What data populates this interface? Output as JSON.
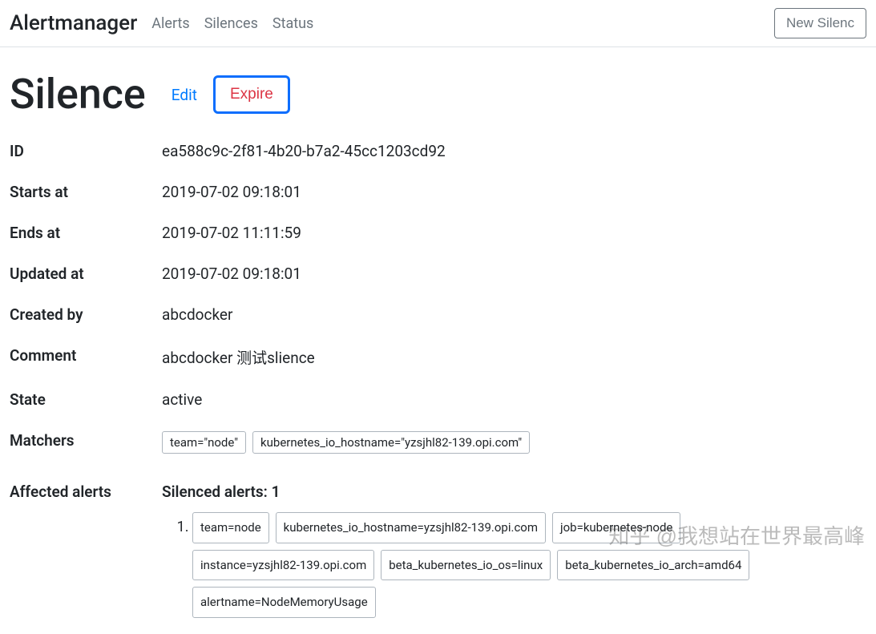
{
  "navbar": {
    "brand": "Alertmanager",
    "links": {
      "alerts": "Alerts",
      "silences": "Silences",
      "status": "Status"
    },
    "new_silence": "New Silenc"
  },
  "page": {
    "title": "Silence",
    "edit": "Edit",
    "expire": "Expire"
  },
  "labels": {
    "id": "ID",
    "starts_at": "Starts at",
    "ends_at": "Ends at",
    "updated_at": "Updated at",
    "created_by": "Created by",
    "comment": "Comment",
    "state": "State",
    "matchers": "Matchers",
    "affected_alerts": "Affected alerts"
  },
  "values": {
    "id": "ea588c9c-2f81-4b20-b7a2-45cc1203cd92",
    "starts_at": "2019-07-02 09:18:01",
    "ends_at": "2019-07-02 11:11:59",
    "updated_at": "2019-07-02 09:18:01",
    "created_by": "abcdocker",
    "comment": "abcdocker 测试slience",
    "state": "active"
  },
  "matchers": [
    "team=\"node\"",
    "kubernetes_io_hostname=\"yzsjhl82-139.opi.com\""
  ],
  "affected": {
    "heading": "Silenced alerts: 1",
    "alerts": [
      [
        "team=node",
        "kubernetes_io_hostname=yzsjhl82-139.opi.com",
        "job=kubernetes-node",
        "instance=yzsjhl82-139.opi.com",
        "beta_kubernetes_io_os=linux",
        "beta_kubernetes_io_arch=amd64",
        "alertname=NodeMemoryUsage"
      ]
    ]
  },
  "watermark": "知乎 @我想站在世界最高峰"
}
